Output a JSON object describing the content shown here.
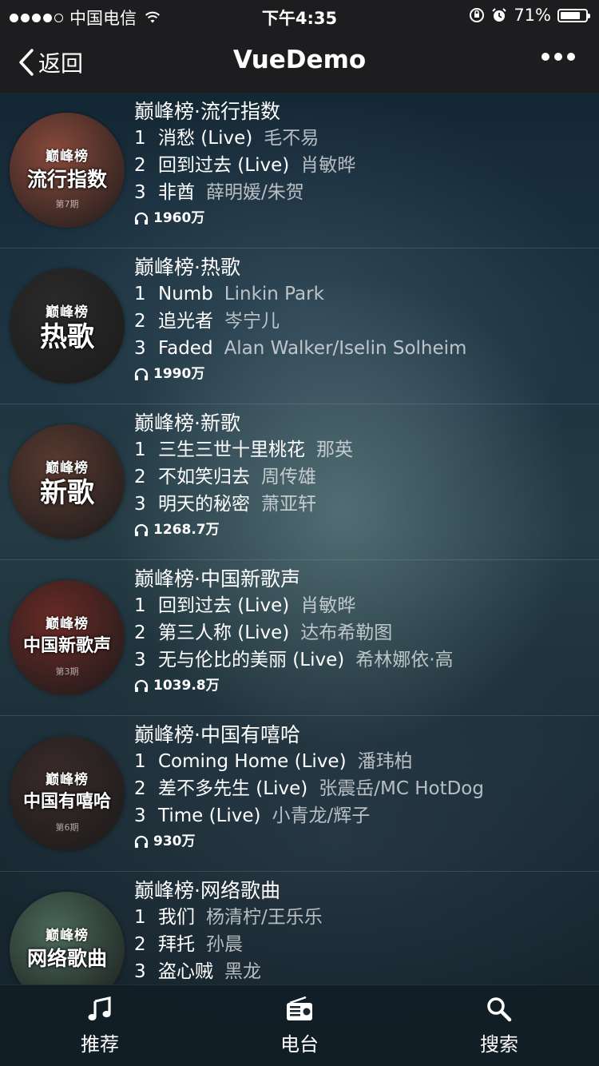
{
  "status_bar": {
    "carrier": "中国电信",
    "time": "下午4:35",
    "battery": "71%"
  },
  "nav": {
    "back_label": "返回",
    "title": "VueDemo"
  },
  "charts": [
    {
      "title": "巅峰榜·流行指数",
      "cover_brand": "巅峰榜",
      "cover_label": "流行指数",
      "cover_sub": "第7期",
      "cover_color": "#8a4a3c",
      "songs": [
        {
          "rank": "1",
          "name": "消愁 (Live)",
          "artist": "毛不易"
        },
        {
          "rank": "2",
          "name": "回到过去 (Live)",
          "artist": "肖敏晔"
        },
        {
          "rank": "3",
          "name": "非酋",
          "artist": "薛明媛/朱贺"
        }
      ],
      "plays": "1960万"
    },
    {
      "title": "巅峰榜·热歌",
      "cover_brand": "巅峰榜",
      "cover_label": "热歌",
      "cover_sub": "",
      "cover_color": "#2b2b2b",
      "songs": [
        {
          "rank": "1",
          "name": "Numb",
          "artist": "Linkin Park"
        },
        {
          "rank": "2",
          "name": "追光者",
          "artist": "岑宁儿"
        },
        {
          "rank": "3",
          "name": "Faded",
          "artist": "Alan Walker/Iselin Solheim"
        }
      ],
      "plays": "1990万"
    },
    {
      "title": "巅峰榜·新歌",
      "cover_brand": "巅峰榜",
      "cover_label": "新歌",
      "cover_sub": "",
      "cover_color": "#5a3a30",
      "songs": [
        {
          "rank": "1",
          "name": "三生三世十里桃花",
          "artist": "那英"
        },
        {
          "rank": "2",
          "name": "不如笑归去",
          "artist": "周传雄"
        },
        {
          "rank": "3",
          "name": "明天的秘密",
          "artist": "萧亚轩"
        }
      ],
      "plays": "1268.7万"
    },
    {
      "title": "巅峰榜·中国新歌声",
      "cover_brand": "巅峰榜",
      "cover_label": "中国新歌声",
      "cover_sub": "第3期",
      "cover_color": "#6a2a26",
      "songs": [
        {
          "rank": "1",
          "name": "回到过去 (Live)",
          "artist": "肖敏晔"
        },
        {
          "rank": "2",
          "name": "第三人称 (Live)",
          "artist": "达布希勒图"
        },
        {
          "rank": "3",
          "name": "无与伦比的美丽 (Live)",
          "artist": "希林娜依·高"
        }
      ],
      "plays": "1039.8万"
    },
    {
      "title": "巅峰榜·中国有嘻哈",
      "cover_brand": "巅峰榜",
      "cover_label": "中国有嘻哈",
      "cover_sub": "第6期",
      "cover_color": "#3a2a2a",
      "songs": [
        {
          "rank": "1",
          "name": "Coming Home (Live)",
          "artist": "潘玮柏"
        },
        {
          "rank": "2",
          "name": "差不多先生 (Live)",
          "artist": "张震岳/MC HotDog"
        },
        {
          "rank": "3",
          "name": "Time (Live)",
          "artist": "小青龙/辉子"
        }
      ],
      "plays": "930万"
    },
    {
      "title": "巅峰榜·网络歌曲",
      "cover_brand": "巅峰榜",
      "cover_label": "网络歌曲",
      "cover_sub": "",
      "cover_color": "#4a6a5a",
      "songs": [
        {
          "rank": "1",
          "name": "我们",
          "artist": "杨清柠/王乐乐"
        },
        {
          "rank": "2",
          "name": "拜托",
          "artist": "孙晨"
        },
        {
          "rank": "3",
          "name": "盗心贼",
          "artist": "黑龙"
        }
      ],
      "plays": ""
    }
  ],
  "tabs": [
    {
      "label": "推荐",
      "icon": "music-note-icon"
    },
    {
      "label": "电台",
      "icon": "radio-icon"
    },
    {
      "label": "搜索",
      "icon": "search-icon"
    }
  ]
}
